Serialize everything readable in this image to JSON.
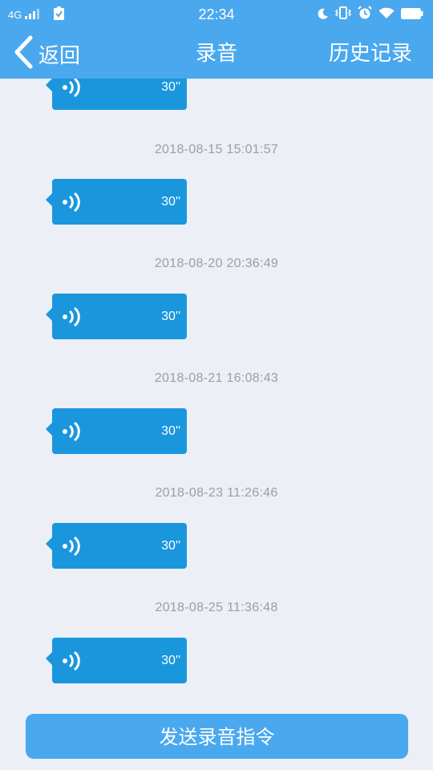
{
  "status_bar": {
    "network": "4G",
    "time": "22:34",
    "icons": [
      "signal-icon",
      "clipboard-check-icon",
      "moon-icon",
      "vibrate-icon",
      "alarm-icon",
      "wifi-icon",
      "battery-icon"
    ]
  },
  "nav": {
    "back_label": "返回",
    "title": "录音",
    "history_label": "历史记录"
  },
  "messages": [
    {
      "time": "",
      "duration": "30''"
    },
    {
      "time": "2018-08-15 15:01:57",
      "duration": "30''"
    },
    {
      "time": "2018-08-20 20:36:49",
      "duration": "30''"
    },
    {
      "time": "2018-08-21 16:08:43",
      "duration": "30''"
    },
    {
      "time": "2018-08-23 11:26:46",
      "duration": "30''"
    },
    {
      "time": "2018-08-25 11:36:48",
      "duration": "30''"
    }
  ],
  "footer": {
    "send_label": "发送录音指令"
  },
  "colors": {
    "header": "#4aa8ee",
    "bubble": "#1a96dd",
    "background": "#eceff5",
    "timestamp": "#9a9ea6"
  }
}
